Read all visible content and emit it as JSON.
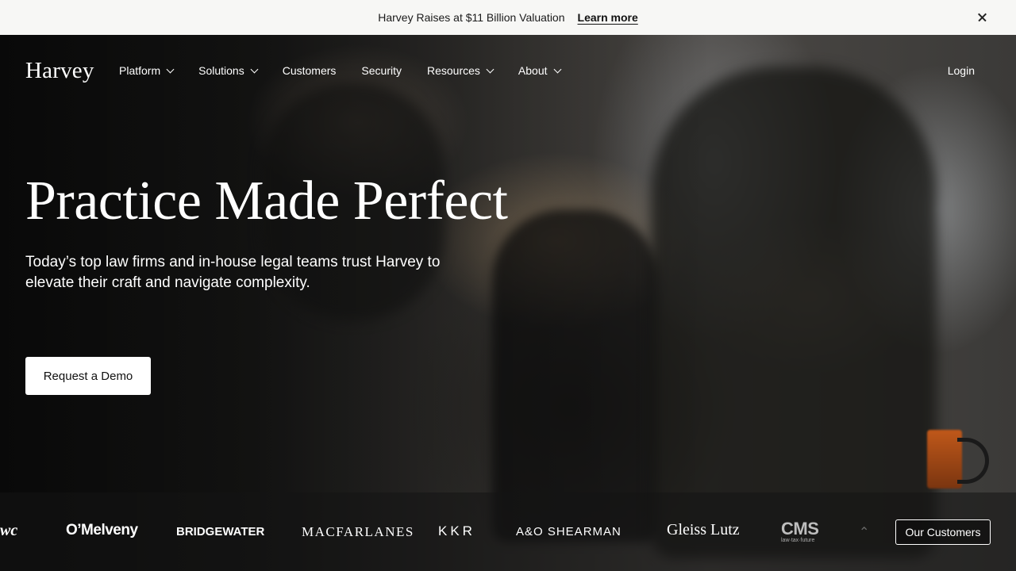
{
  "announcement": {
    "message": "Harvey Raises at $11 Billion Valuation",
    "link_label": "Learn more",
    "close_icon": "close-icon"
  },
  "nav": {
    "logo": "Harvey",
    "items": [
      {
        "label": "Platform",
        "has_dropdown": true
      },
      {
        "label": "Solutions",
        "has_dropdown": true
      },
      {
        "label": "Customers",
        "has_dropdown": false
      },
      {
        "label": "Security",
        "has_dropdown": false
      },
      {
        "label": "Resources",
        "has_dropdown": true
      },
      {
        "label": "About",
        "has_dropdown": true
      }
    ],
    "login": "Login"
  },
  "hero": {
    "headline": "Practice Made Perfect",
    "subheadline": "Today’s top law firms and in-house legal teams trust Harvey to elevate their craft and navigate complexity.",
    "cta": "Request a Demo"
  },
  "customers": {
    "logos": [
      "wc",
      "O’Melveny",
      "BRIDGEWATER",
      "MACFARLANES",
      "KKR",
      "A&O SHEARMAN",
      "Gleiss Lutz",
      "CMS",
      "law·tax·future"
    ],
    "button": "Our Customers"
  },
  "colors": {
    "announcement_bg": "#f7f7f5",
    "hero_text": "#ffffff",
    "cta_bg": "#ffffff"
  }
}
